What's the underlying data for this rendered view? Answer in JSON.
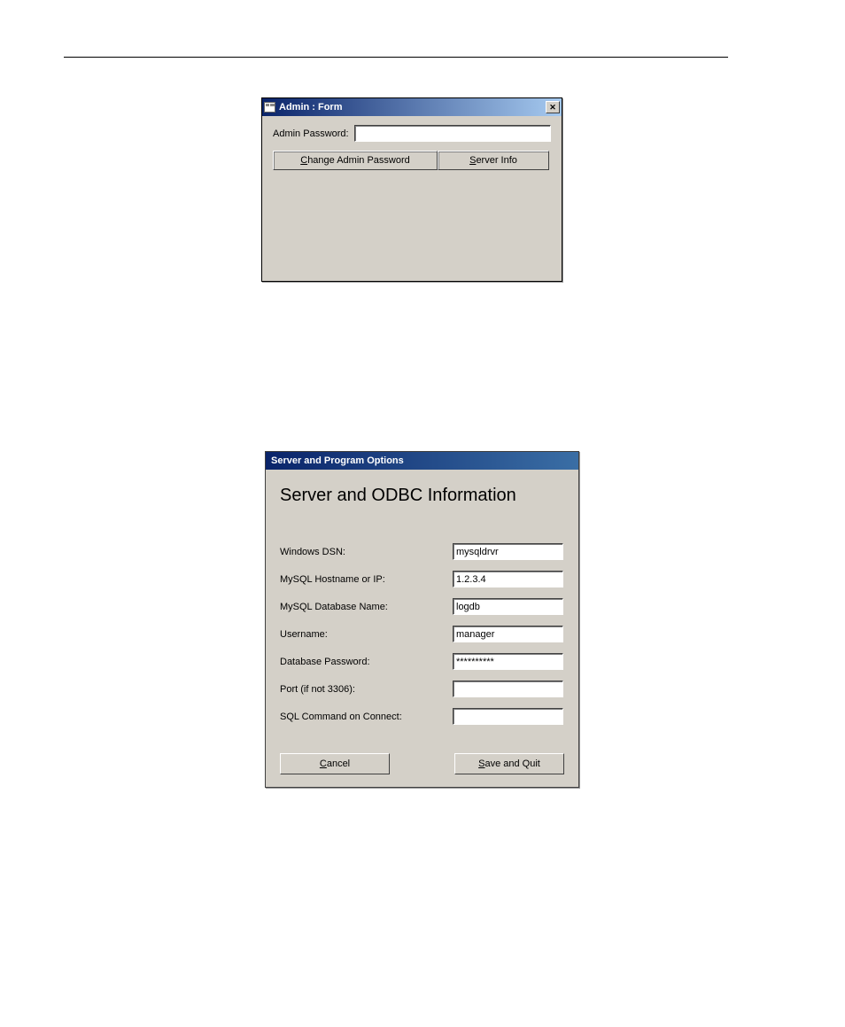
{
  "window1": {
    "title": "Admin : Form",
    "password_label": "Admin Password:",
    "password_value": "",
    "change_button_label": "Change Admin Password",
    "server_button_label": "Server Info"
  },
  "window2": {
    "title": "Server and Program Options",
    "heading": "Server and ODBC Information",
    "rows": [
      {
        "label": "Windows DSN:",
        "value": "mysqldrvr"
      },
      {
        "label": "MySQL Hostname or IP:",
        "value": "1.2.3.4"
      },
      {
        "label": "MySQL Database Name:",
        "value": "logdb"
      },
      {
        "label": "Username:",
        "value": "manager"
      },
      {
        "label": "Database Password:",
        "value": "**********"
      },
      {
        "label": "Port (if not 3306):",
        "value": ""
      },
      {
        "label": "SQL Command on Connect:",
        "value": ""
      }
    ],
    "cancel_label": "Cancel",
    "save_label": "Save and Quit"
  }
}
